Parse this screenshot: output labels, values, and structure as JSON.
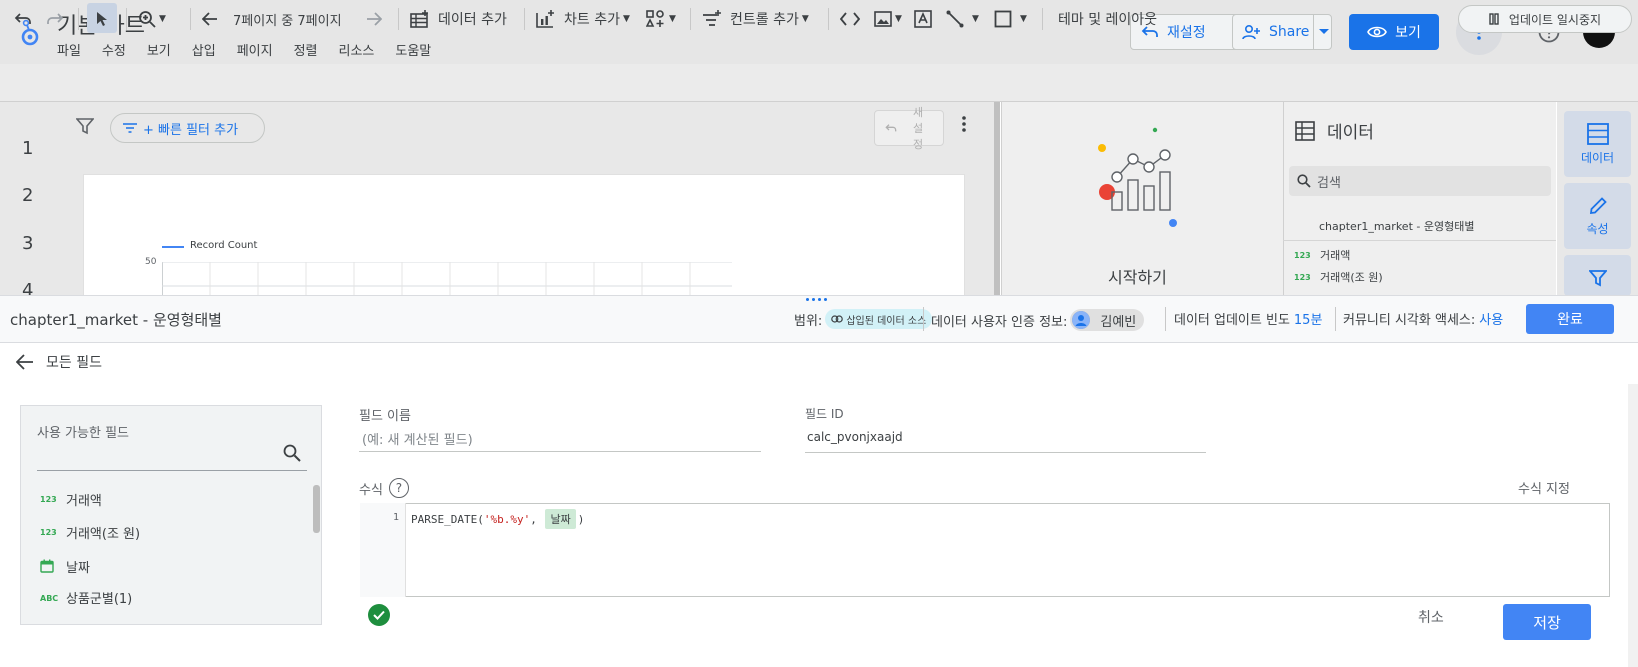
{
  "app": {
    "title": "기본 차트",
    "menu": [
      "파일",
      "수정",
      "보기",
      "삽입",
      "페이지",
      "정렬",
      "리소스",
      "도움말"
    ],
    "reset_label": "재설정",
    "share_label": "Share",
    "view_label": "보기"
  },
  "toolbar": {
    "page_nav": "7페이지 중 7페이지",
    "add_data": "데이터 추가",
    "add_chart": "차트 추가",
    "add_control": "컨트롤 추가",
    "theme_layout": "테마 및 레이아웃",
    "pause_updates": "업데이트 일시중지"
  },
  "canvas": {
    "row_numbers": [
      "1",
      "2",
      "3",
      "4"
    ],
    "quick_filter": "+ 빠른 필터 추가",
    "reset_mini": "새설정",
    "legend": "Record Count",
    "y_tick": "50"
  },
  "start_panel": {
    "label": "시작하기"
  },
  "data_panel": {
    "title": "데이터",
    "search_placeholder": "검색",
    "source": "chapter1_market - 운영형태별",
    "fields": [
      {
        "type": "123",
        "name": "거래액"
      },
      {
        "type": "123",
        "name": "거래액(조 원)"
      }
    ]
  },
  "rail": {
    "data": "데이터",
    "properties": "속성"
  },
  "editor": {
    "source_title": "chapter1_market - 운영형태별",
    "scope_label": "범위:",
    "scope_value": "삽입된 데이터 소스",
    "cred_label": "데이터 사용자 인증 정보:",
    "cred_user": "김예빈",
    "freshness_label": "데이터 업데이트 빈도",
    "freshness_value": "15분",
    "community_label": "커뮤니티 시각화 액세스:",
    "community_value": "사용",
    "done_label": "완료"
  },
  "nav": {
    "back_label": "모든 필드"
  },
  "available_fields": {
    "title": "사용 가능한 필드",
    "items": [
      {
        "type": "123",
        "name": "거래액"
      },
      {
        "type": "123",
        "name": "거래액(조 원)"
      },
      {
        "type": "date",
        "name": "날짜"
      },
      {
        "type": "ABC",
        "name": "상품군별(1)"
      }
    ]
  },
  "form": {
    "field_name_label": "필드 이름",
    "field_name_placeholder": "(예: 새 계산된 필드)",
    "field_id_label": "필드 ID",
    "field_id_value": "calc_pvonjxaajd",
    "formula_label": "수식",
    "format_label": "수식 지정",
    "line_number": "1",
    "code_fn": "PARSE_DATE(",
    "code_str": "'%b.%y'",
    "code_sep": ", ",
    "code_field": "날짜",
    "code_end": ")",
    "cancel_label": "취소",
    "save_label": "저장"
  },
  "colors": {
    "accent": "#1a73e8",
    "success": "#1e8e3e"
  }
}
